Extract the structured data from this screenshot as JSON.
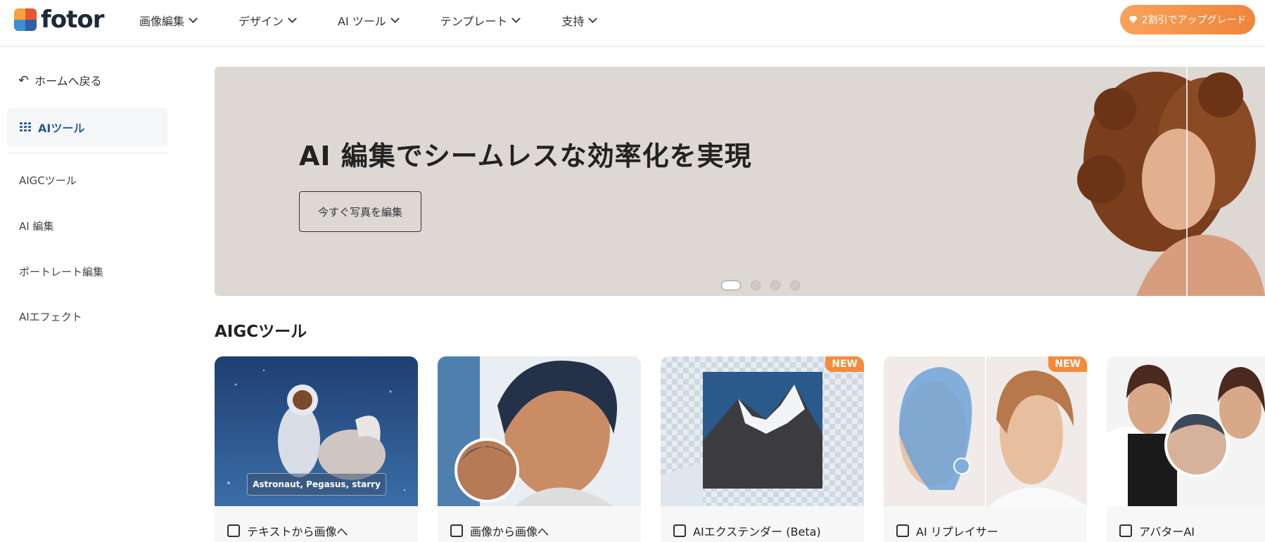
{
  "header": {
    "logo_text": "fotor",
    "nav": [
      {
        "label": "画像編集"
      },
      {
        "label": "デザイン"
      },
      {
        "label": "AI ツール"
      },
      {
        "label": "テンプレート"
      },
      {
        "label": "支持"
      }
    ],
    "upgrade_label": "2割引でアップグレード"
  },
  "sidebar": {
    "back_label": "ホームへ戻る",
    "active_label": "AIツール",
    "items": [
      {
        "label": "AIGCツール"
      },
      {
        "label": "AI 編集"
      },
      {
        "label": "ポートレート編集"
      },
      {
        "label": "AIエフェクト"
      }
    ]
  },
  "banner": {
    "title": "AI 編集でシームレスな効率化を実現",
    "button_label": "今すぐ写真を編集",
    "slide_count": 4,
    "active_slide": 1
  },
  "section": {
    "title": "AIGCツール",
    "cards": [
      {
        "label": "テキストから画像へ",
        "icon": "text-to-image-icon",
        "caption": "Astronaut, Pegasus, starry",
        "badge": ""
      },
      {
        "label": "画像から画像へ",
        "icon": "image-to-image-icon",
        "badge": ""
      },
      {
        "label": "AIエクステンダー (Beta)",
        "icon": "expand-icon",
        "badge": "NEW"
      },
      {
        "label": "AI リプレイサー",
        "icon": "replace-icon",
        "badge": "NEW"
      },
      {
        "label": "アバターAI",
        "icon": "avatar-icon",
        "badge": ""
      }
    ]
  },
  "colors": {
    "accent": "#f0843a",
    "active_nav": "#2c5a96",
    "banner_bg": "#ddd8d4"
  }
}
